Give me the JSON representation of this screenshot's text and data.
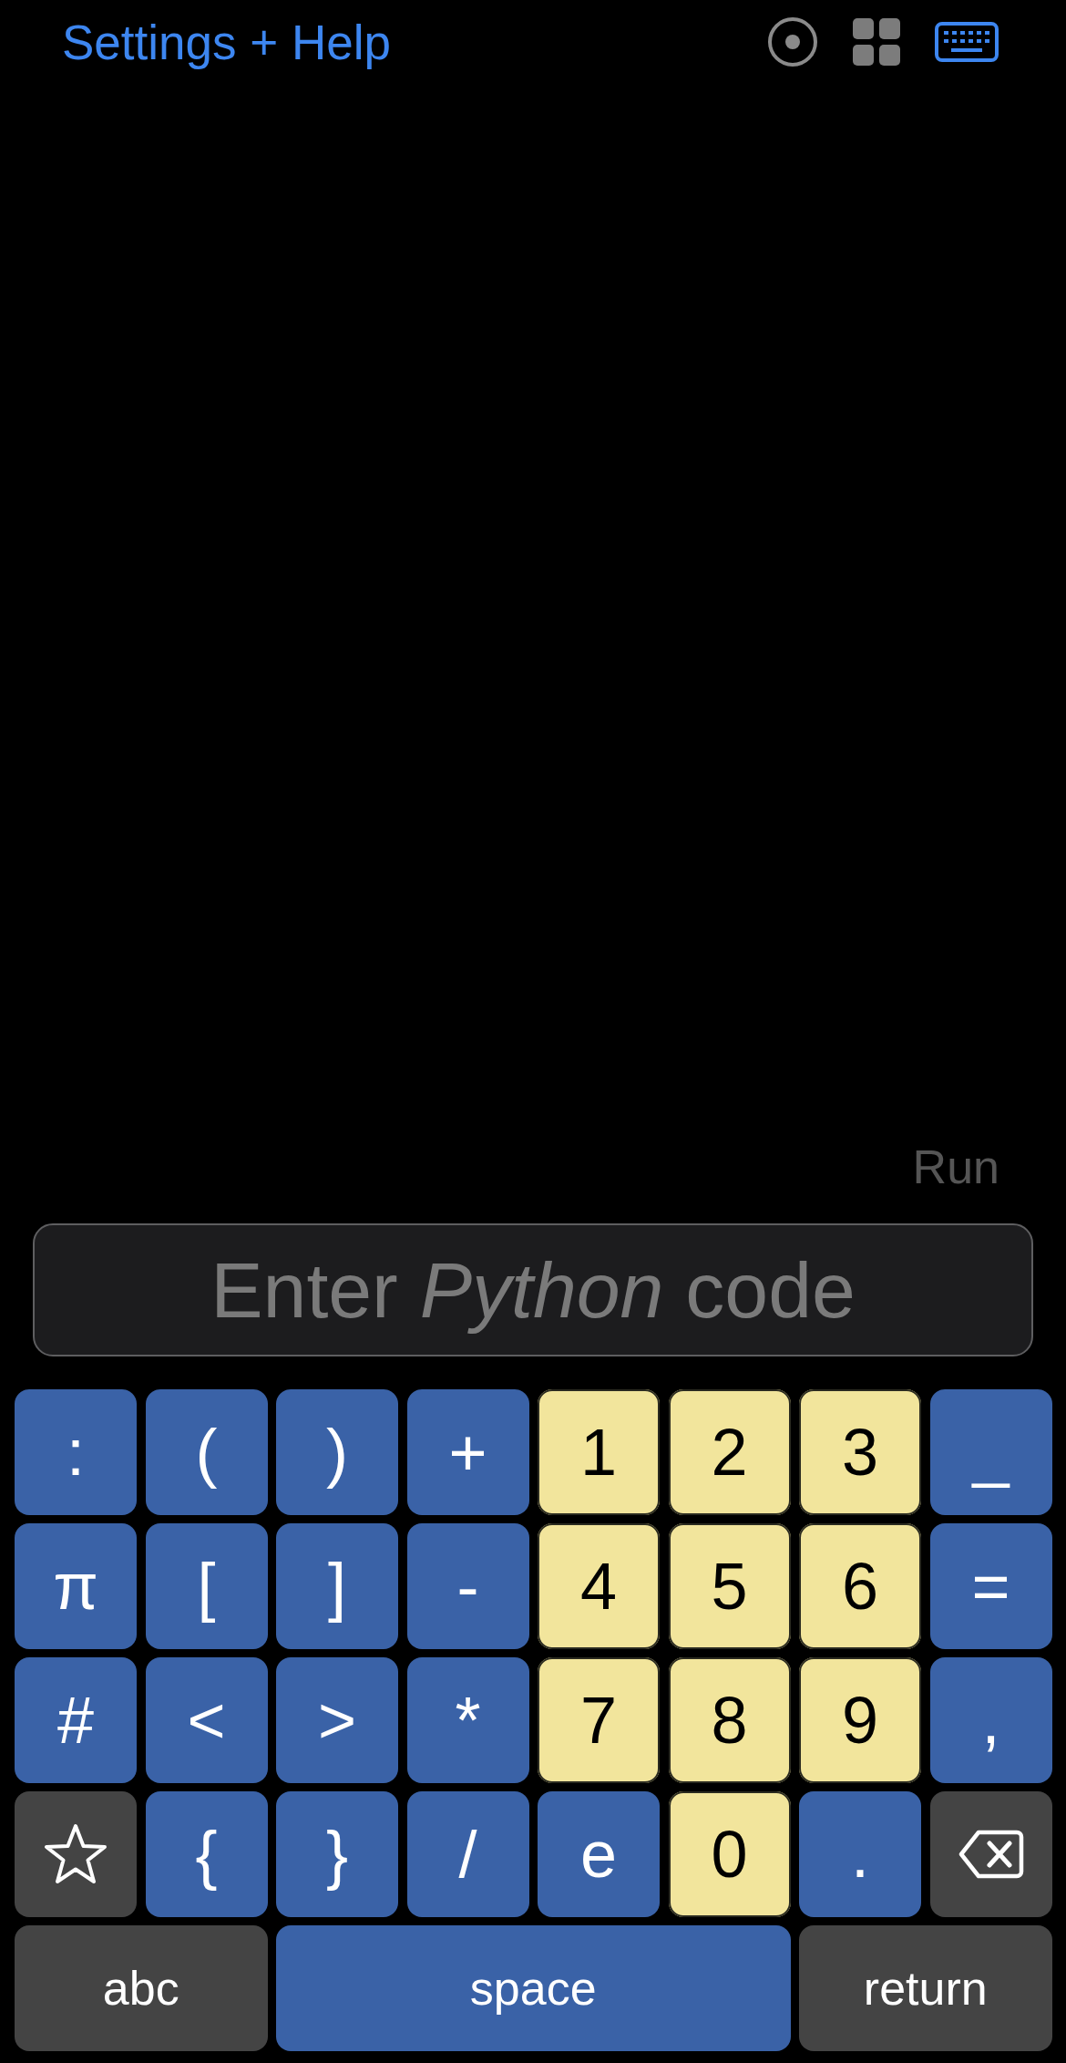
{
  "header": {
    "link": "Settings + Help"
  },
  "run_label": "Run",
  "code_input": {
    "placeholder": "Enter *Python* code"
  },
  "keyboard": {
    "rows": [
      [
        {
          "label": ":",
          "kind": "symbol"
        },
        {
          "label": "(",
          "kind": "symbol"
        },
        {
          "label": ")",
          "kind": "symbol"
        },
        {
          "label": "+",
          "kind": "symbol"
        },
        {
          "label": "1",
          "kind": "digit"
        },
        {
          "label": "2",
          "kind": "digit"
        },
        {
          "label": "3",
          "kind": "digit"
        },
        {
          "label": "_",
          "kind": "symbol"
        }
      ],
      [
        {
          "label": "π",
          "kind": "symbol"
        },
        {
          "label": "[",
          "kind": "symbol"
        },
        {
          "label": "]",
          "kind": "symbol"
        },
        {
          "label": "-",
          "kind": "symbol"
        },
        {
          "label": "4",
          "kind": "digit"
        },
        {
          "label": "5",
          "kind": "digit"
        },
        {
          "label": "6",
          "kind": "digit"
        },
        {
          "label": "=",
          "kind": "symbol"
        }
      ],
      [
        {
          "label": "#",
          "kind": "symbol"
        },
        {
          "label": "<",
          "kind": "symbol"
        },
        {
          "label": ">",
          "kind": "symbol"
        },
        {
          "label": "*",
          "kind": "symbol"
        },
        {
          "label": "7",
          "kind": "digit"
        },
        {
          "label": "8",
          "kind": "digit"
        },
        {
          "label": "9",
          "kind": "digit"
        },
        {
          "label": ",",
          "kind": "symbol"
        }
      ],
      [
        {
          "kind": "star"
        },
        {
          "label": "{",
          "kind": "symbol"
        },
        {
          "label": "}",
          "kind": "symbol"
        },
        {
          "label": "/",
          "kind": "symbol"
        },
        {
          "label": "e",
          "kind": "symbol"
        },
        {
          "label": "0",
          "kind": "digit"
        },
        {
          "label": ".",
          "kind": "symbol"
        },
        {
          "kind": "delete"
        }
      ]
    ],
    "bottom_row": [
      {
        "label": "abc",
        "kind": "function"
      },
      {
        "label": "space",
        "kind": "symbol"
      },
      {
        "label": "return",
        "kind": "function"
      }
    ]
  }
}
